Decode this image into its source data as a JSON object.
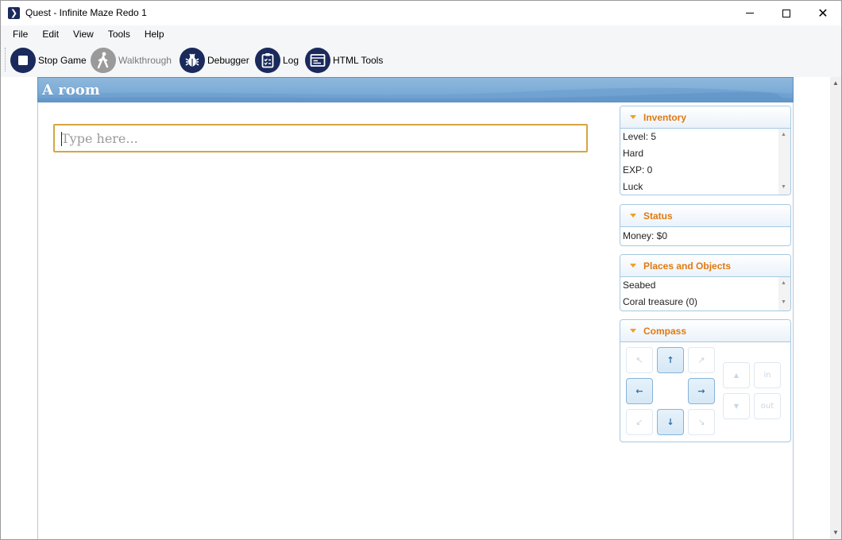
{
  "window": {
    "title": "Quest - Infinite Maze Redo 1",
    "app_icon_glyph": "❯",
    "controls": {
      "minimize": "minimize-icon",
      "maximize": "maximize-icon",
      "close": "✕"
    }
  },
  "menu": [
    "File",
    "Edit",
    "View",
    "Tools",
    "Help"
  ],
  "toolbar": {
    "stop_game": "Stop Game",
    "walkthrough": "Walkthrough",
    "debugger": "Debugger",
    "log": "Log",
    "html_tools": "HTML Tools"
  },
  "game": {
    "room_title": "A room",
    "command_placeholder": "Type here..."
  },
  "panes": {
    "inventory": {
      "title": "Inventory",
      "items": [
        "Level: 5",
        "Hard",
        "EXP: 0",
        "Luck"
      ]
    },
    "status": {
      "title": "Status",
      "items": [
        "Money: $0"
      ]
    },
    "places": {
      "title": "Places and Objects",
      "items": [
        "Seabed",
        "Coral treasure (0)"
      ]
    },
    "compass": {
      "title": "Compass",
      "buttons": {
        "nw": "↖",
        "n": "↑",
        "ne": "↗",
        "w": "←",
        "e": "→",
        "sw": "↙",
        "s": "↓",
        "se": "↘",
        "up": "▲",
        "down": "▼",
        "in": "in",
        "out": "out"
      },
      "enabled": [
        "n",
        "w",
        "e",
        "s"
      ]
    }
  },
  "colors": {
    "toolbar_icon": "#1b2a5c",
    "pane_title": "#e07a10",
    "input_border": "#d4a643",
    "room_header": "#7faed8"
  }
}
